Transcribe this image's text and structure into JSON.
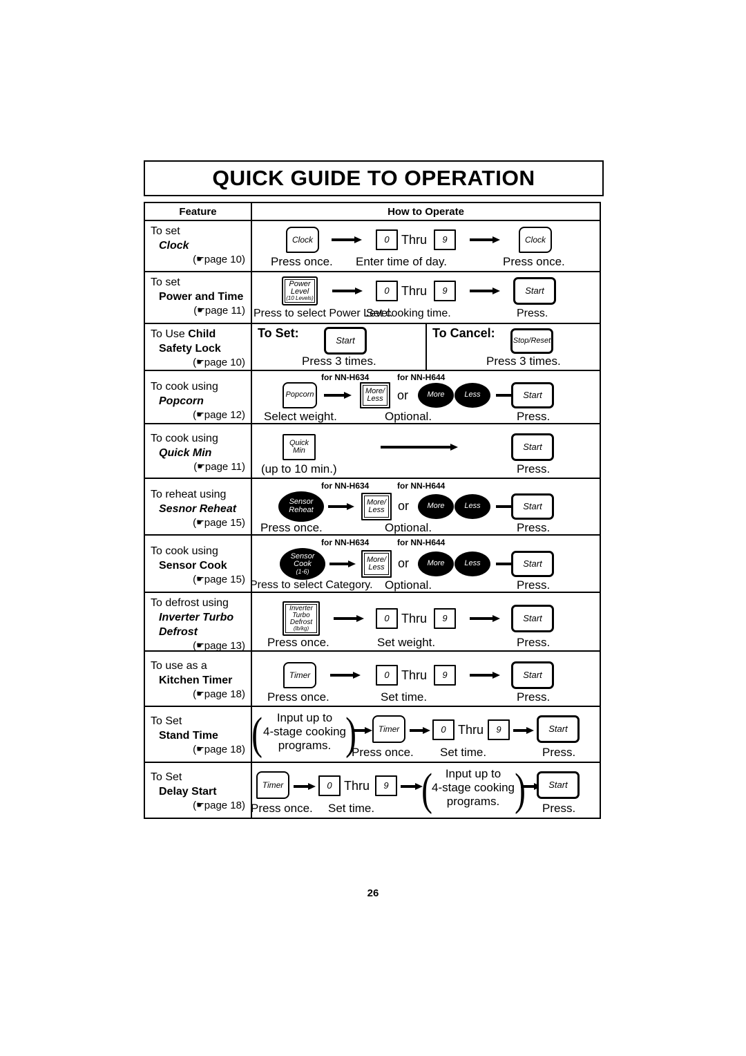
{
  "title": "QUICK GUIDE TO OPERATION",
  "page_number": "26",
  "table": {
    "headers": {
      "feature": "Feature",
      "how_to_operate": "How to Operate"
    },
    "rows": [
      {
        "id": "clock",
        "feature": {
          "line1": "To set",
          "name": "Clock",
          "page_ref": "page 10"
        },
        "buttons": [
          {
            "name": "Clock",
            "caption": "Press once."
          },
          {
            "name": "0",
            "thru": "Thru",
            "name2": "9",
            "caption": "Enter time of day."
          },
          {
            "name": "Clock",
            "caption": "Press once."
          }
        ]
      },
      {
        "id": "power-and-time",
        "feature": {
          "line1": "To set",
          "name": "Power and Time",
          "page_ref": "page 11"
        },
        "buttons": [
          {
            "name": "Power Level (10 Levels)",
            "caption": "Press to select Power Level."
          },
          {
            "name": "0",
            "thru": "Thru",
            "name2": "9",
            "caption": "Set cooking time."
          },
          {
            "name": "Start",
            "caption": "Press."
          }
        ]
      },
      {
        "id": "child-safety-lock",
        "feature": {
          "line1": "To Use Child",
          "name": "Safety Lock",
          "page_ref": "page 10"
        },
        "to_set_label": "To Set:",
        "to_cancel_label": "To Cancel:",
        "set_button": "Start",
        "set_caption": "Press 3 times.",
        "cancel_button": "Stop/Reset",
        "cancel_caption": "Press 3 times."
      },
      {
        "id": "popcorn",
        "feature": {
          "line1": "To cook using",
          "name": "Popcorn",
          "page_ref": "page 12"
        },
        "tag_h634": "for NN-H634",
        "tag_h644": "for NN-H644",
        "or_label": "or",
        "buttons": [
          {
            "name": "Popcorn",
            "caption": "Select weight."
          },
          {
            "name": "More/ Less",
            "caption": "Optional."
          },
          {
            "name": "More",
            "name2": "Less"
          },
          {
            "name": "Start",
            "caption": "Press."
          }
        ]
      },
      {
        "id": "quick-min",
        "feature": {
          "line1": "To cook using",
          "name": "Quick Min",
          "page_ref": "page 11"
        },
        "buttons": [
          {
            "name": "Quick Min",
            "caption": "(up to 10 min.)"
          },
          {
            "name": "Start",
            "caption": "Press."
          }
        ]
      },
      {
        "id": "sensor-reheat",
        "feature": {
          "line1": "To reheat using",
          "name": "Sesnor Reheat",
          "page_ref": "page 15"
        },
        "tag_h634": "for NN-H634",
        "tag_h644": "for NN-H644",
        "or_label": "or",
        "buttons": [
          {
            "name": "Sensor Reheat",
            "caption": "Press once."
          },
          {
            "name": "More/ Less",
            "caption": "Optional."
          },
          {
            "name": "More",
            "name2": "Less"
          },
          {
            "name": "Start",
            "caption": "Press."
          }
        ]
      },
      {
        "id": "sensor-cook",
        "feature": {
          "line1": "To cook using",
          "name": "Sensor Cook",
          "page_ref": "page 15"
        },
        "tag_h634": "for NN-H634",
        "tag_h644": "for NN-H644",
        "or_label": "or",
        "buttons": [
          {
            "name": "Sensor Cook (1-6)",
            "caption": "Press to select Category."
          },
          {
            "name": "More/ Less",
            "caption": "Optional."
          },
          {
            "name": "More",
            "name2": "Less"
          },
          {
            "name": "Start",
            "caption": "Press."
          }
        ]
      },
      {
        "id": "inverter-turbo-defrost",
        "feature": {
          "line1": "To defrost using",
          "name": "Inverter Turbo",
          "name_line2": "Defrost",
          "page_ref": "page 13"
        },
        "buttons": [
          {
            "name": "Inverter Turbo Defrost (lb/kg)",
            "caption": "Press once."
          },
          {
            "name": "0",
            "thru": "Thru",
            "name2": "9",
            "caption": "Set weight."
          },
          {
            "name": "Start",
            "caption": "Press."
          }
        ]
      },
      {
        "id": "kitchen-timer",
        "feature": {
          "line1": "To use as a",
          "name": "Kitchen Timer",
          "page_ref": "page 18"
        },
        "buttons": [
          {
            "name": "Timer",
            "caption": "Press once."
          },
          {
            "name": "0",
            "thru": "Thru",
            "name2": "9",
            "caption": "Set time."
          },
          {
            "name": "Start",
            "caption": "Press."
          }
        ]
      },
      {
        "id": "stand-time",
        "feature": {
          "line1": "To Set",
          "name": "Stand Time",
          "page_ref": "page 18"
        },
        "note": "Input up to\n4-stage cooking\nprograms.",
        "note_l1": "Input up to",
        "note_l2": "4-stage cooking",
        "note_l3": "programs.",
        "buttons": [
          {
            "name": "Timer",
            "caption": "Press once."
          },
          {
            "name": "0",
            "thru": "Thru",
            "name2": "9",
            "caption": "Set time."
          },
          {
            "name": "Start",
            "caption": "Press."
          }
        ]
      },
      {
        "id": "delay-start",
        "feature": {
          "line1": "To Set",
          "name": "Delay Start",
          "page_ref": "page 18"
        },
        "note_l1": "Input up to",
        "note_l2": "4-stage cooking",
        "note_l3": "programs.",
        "buttons": [
          {
            "name": "Timer",
            "caption": "Press once."
          },
          {
            "name": "0",
            "thru": "Thru",
            "name2": "9",
            "caption": "Set time."
          },
          {
            "name": "Start",
            "caption": "Press."
          }
        ]
      }
    ]
  },
  "glyphs": {
    "hand": "☛",
    "lparen": "(",
    "rparen": ")",
    "open": "(",
    "close": ")"
  },
  "button_text": {
    "clock": "Clock",
    "start": "Start",
    "stop_reset": "Stop/Reset",
    "popcorn": "Popcorn",
    "timer": "Timer",
    "zero": "0",
    "nine": "9",
    "thru": "Thru",
    "more_slash": "More/",
    "less": "Less",
    "more": "More",
    "power": "Power",
    "level": "Level",
    "ten_levels": "(10 Levels)",
    "quick": "Quick",
    "min": "Min",
    "sensor": "Sensor",
    "reheat": "Reheat",
    "cook": "Cook",
    "range16": "(1-6)",
    "inverter": "Inverter",
    "turbo": "Turbo",
    "defrost": "Defrost",
    "lbkg": "(lb/kg)"
  }
}
